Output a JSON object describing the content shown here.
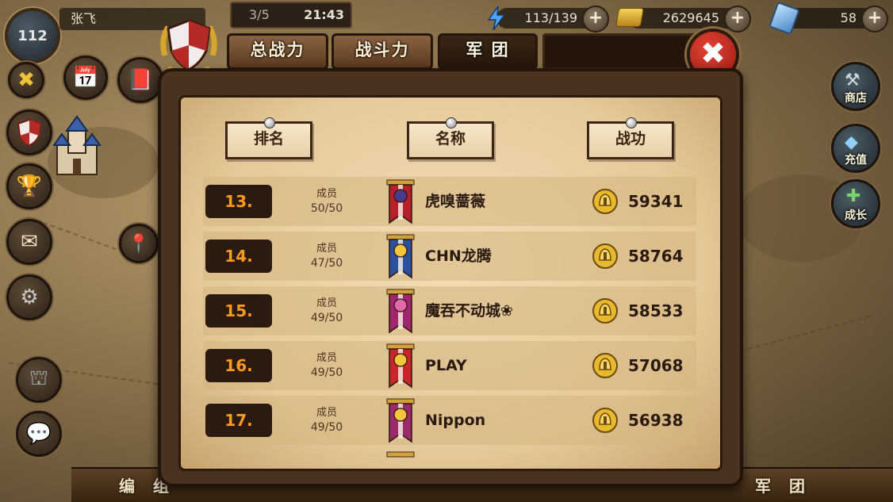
{
  "player": {
    "level": "112",
    "name": "张飞"
  },
  "clock": {
    "prefix": "3/5",
    "time": "21:43"
  },
  "resources": [
    {
      "name": "energy",
      "icon": "lightning-icon",
      "value": "113/139"
    },
    {
      "name": "gold",
      "icon": "gold-ingot-icon",
      "value": "2629645"
    },
    {
      "name": "gems",
      "icon": "diamond-icon",
      "value": "58"
    }
  ],
  "tabs": [
    {
      "label": "总战力",
      "active": false
    },
    {
      "label": "战斗力",
      "active": false
    },
    {
      "label": "军 团",
      "active": true
    }
  ],
  "columns": {
    "rank": "排名",
    "name": "名称",
    "merit": "战功"
  },
  "rows": [
    {
      "rank": "13.",
      "members_label": "成员",
      "members": "50/50",
      "name": "虎嗅蔷薇",
      "merit": "59341",
      "banner_color": "#b5202a",
      "banner_emblem": "#4a3a8a"
    },
    {
      "rank": "14.",
      "members_label": "成员",
      "members": "47/50",
      "name": "CHN龙腾",
      "merit": "58764",
      "banner_color": "#2c4f9e",
      "banner_emblem": "#f3c63b"
    },
    {
      "rank": "15.",
      "members_label": "成员",
      "members": "49/50",
      "name": "魔吞不动城❀",
      "merit": "58533",
      "banner_color": "#a0266e",
      "banner_emblem": "#e069a8"
    },
    {
      "rank": "16.",
      "members_label": "成员",
      "members": "49/50",
      "name": "PLAY",
      "merit": "57068",
      "banner_color": "#c8262a",
      "banner_emblem": "#f3c63b"
    },
    {
      "rank": "17.",
      "members_label": "成员",
      "members": "49/50",
      "name": "Nippon",
      "merit": "56938",
      "banner_color": "#9c2a6a",
      "banner_emblem": "#f3c63b"
    }
  ],
  "right_buttons": [
    {
      "label": "商店"
    },
    {
      "label": "充值"
    },
    {
      "label": "成长"
    }
  ],
  "bottom_nav": [
    {
      "label": "编 组"
    },
    {
      "label": "军 团"
    }
  ],
  "colors": {
    "rank_text": "#ff9a1f",
    "close_button": "#d8352a",
    "parchment": "#eed7ad"
  }
}
